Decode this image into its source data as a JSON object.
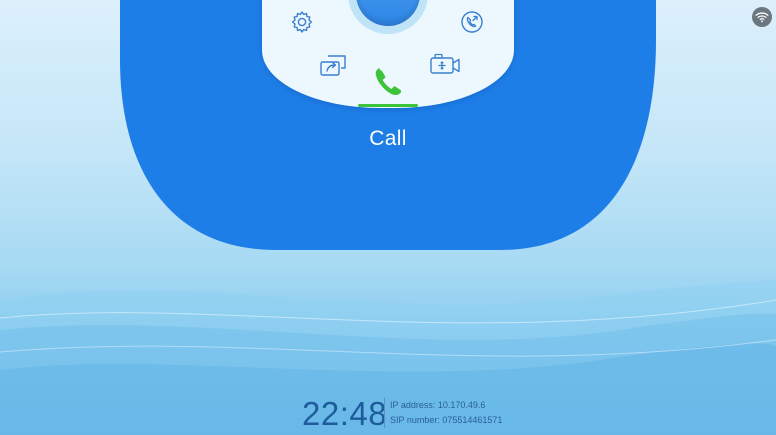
{
  "status_bar": {
    "wifi_icon": "wifi-icon"
  },
  "dial": {
    "icons": {
      "settings": "gear-icon",
      "history": "call-history-icon",
      "share": "screen-share-icon",
      "camera": "video-camera-icon",
      "call": "phone-icon"
    },
    "active_mode_label": "Call",
    "colors": {
      "blob": "#1e7ee8",
      "accent_green": "#3ec43a",
      "panel": "#ecf8fd"
    }
  },
  "footer": {
    "time": "22:48",
    "ip_address_text": "IP address: 10.170.49.6",
    "sip_number_text": "SIP number: 075514461571"
  }
}
